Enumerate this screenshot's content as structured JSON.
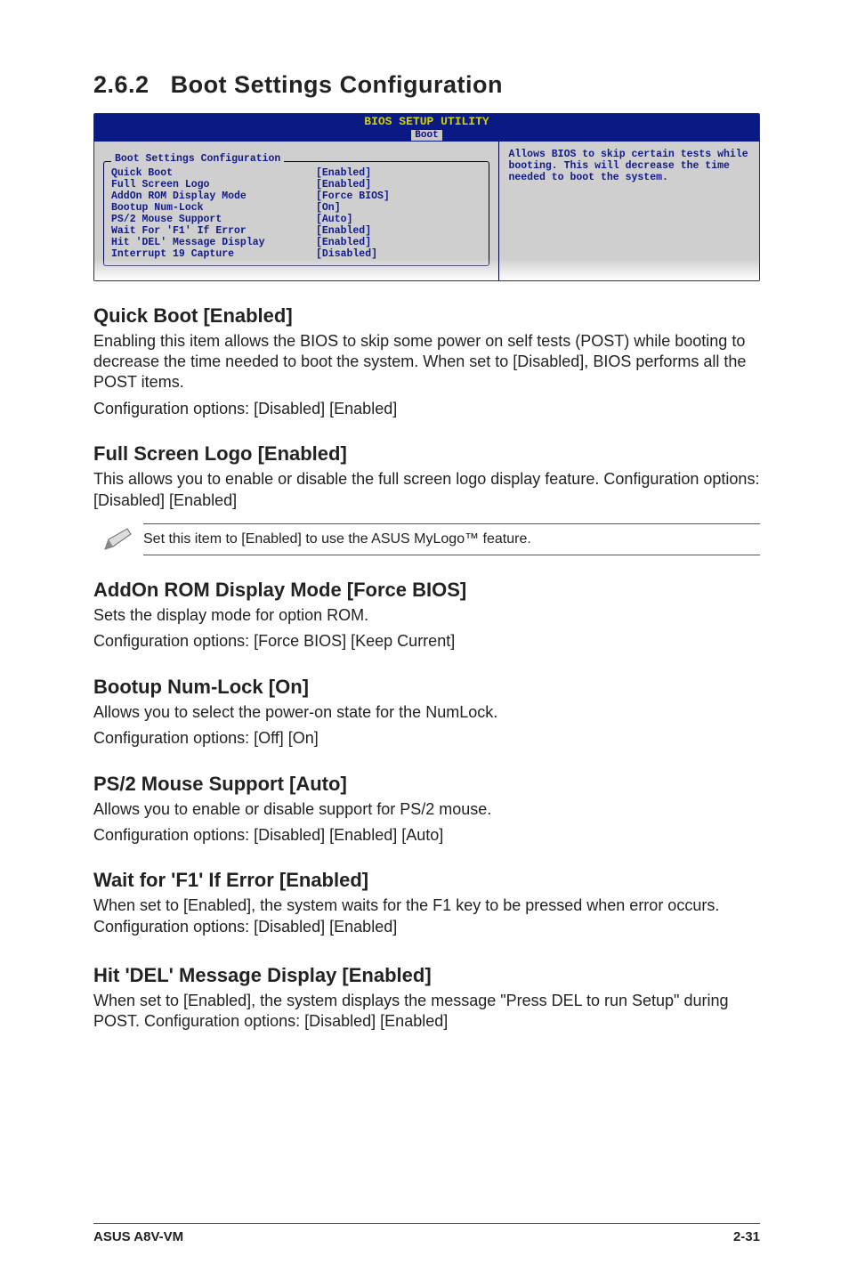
{
  "section": {
    "number": "2.6.2",
    "title": "Boot Settings Configuration"
  },
  "bios": {
    "header_title": "BIOS SETUP UTILITY",
    "header_tab": "Boot",
    "panel_title": "Boot Settings Configuration",
    "help_text": "Allows BIOS to skip certain tests while booting. This will decrease the time needed to boot the system.",
    "rows": [
      {
        "name": "Quick Boot",
        "value": "[Enabled]"
      },
      {
        "name": "Full Screen Logo",
        "value": "[Enabled]"
      },
      {
        "name": "AddOn ROM Display Mode",
        "value": "[Force BIOS]"
      },
      {
        "name": "Bootup Num-Lock",
        "value": "[On]"
      },
      {
        "name": "PS/2 Mouse Support",
        "value": "[Auto]"
      },
      {
        "name": "Wait For 'F1' If Error",
        "value": "[Enabled]"
      },
      {
        "name": "Hit 'DEL' Message Display",
        "value": "[Enabled]"
      },
      {
        "name": "Interrupt 19 Capture",
        "value": "[Disabled]"
      }
    ]
  },
  "items": {
    "quick_boot": {
      "heading": "Quick Boot [Enabled]",
      "p1": "Enabling this item allows the BIOS to skip some power on self tests (POST) while booting to decrease the time needed to boot the system. When set to [Disabled], BIOS performs all the POST items.",
      "p2": "Configuration options: [Disabled] [Enabled]"
    },
    "full_screen": {
      "heading": "Full Screen Logo [Enabled]",
      "p1": "This allows you to enable or disable the full screen logo display feature. Configuration options: [Disabled] [Enabled]",
      "note": "Set this item to [Enabled] to use the ASUS MyLogo™ feature."
    },
    "addon_rom": {
      "heading": "AddOn ROM Display Mode [Force BIOS]",
      "p1": "Sets the display mode for option ROM.",
      "p2": "Configuration options: [Force BIOS] [Keep Current]"
    },
    "numlock": {
      "heading": "Bootup Num-Lock [On]",
      "p1": "Allows you to select the power-on state for the NumLock.",
      "p2": "Configuration options: [Off] [On]"
    },
    "ps2": {
      "heading": "PS/2 Mouse Support [Auto]",
      "p1": "Allows you to enable or disable support for PS/2 mouse.",
      "p2": "Configuration options: [Disabled] [Enabled] [Auto]"
    },
    "f1": {
      "heading": "Wait for 'F1' If Error [Enabled]",
      "p1": "When set to [Enabled], the system waits for the F1 key to be pressed when error occurs. Configuration options: [Disabled] [Enabled]"
    },
    "del": {
      "heading": "Hit 'DEL' Message Display [Enabled]",
      "p1": "When set to [Enabled], the system displays the message \"Press DEL to run Setup\" during POST. Configuration options: [Disabled] [Enabled]"
    }
  },
  "footer": {
    "left": "ASUS A8V-VM",
    "right": "2-31"
  }
}
